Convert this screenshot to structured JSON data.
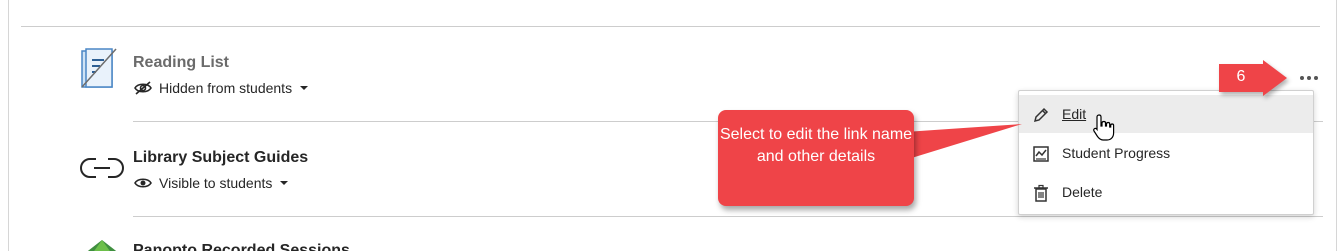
{
  "items": [
    {
      "title": "Reading List",
      "visibility": "Hidden from students",
      "icon": "reading-list-icon",
      "visibility_icon": "eye-slash-icon"
    },
    {
      "title": "Library Subject Guides",
      "visibility": "Visible to students",
      "icon": "link-icon",
      "visibility_icon": "eye-icon"
    },
    {
      "title": "Panopto Recorded Sessions",
      "icon": "panopto-icon"
    }
  ],
  "menu": {
    "items": [
      {
        "label": "Edit",
        "icon": "pencil-icon"
      },
      {
        "label": "Student Progress",
        "icon": "student-progress-icon"
      },
      {
        "label": "Delete",
        "icon": "trash-icon"
      }
    ]
  },
  "callout": {
    "text": "Select to edit the link name and other details"
  },
  "step_badge": {
    "number": "6"
  },
  "colors": {
    "accent_red": "#ef4448",
    "menu_hover": "#ececec",
    "divider": "#cdcdcd"
  }
}
